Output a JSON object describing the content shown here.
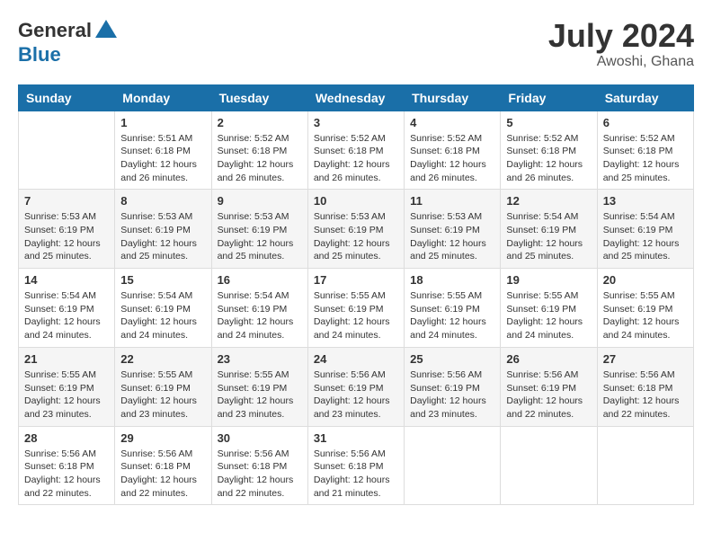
{
  "header": {
    "logo_general": "General",
    "logo_blue": "Blue",
    "month_year": "July 2024",
    "location": "Awoshi, Ghana"
  },
  "days_of_week": [
    "Sunday",
    "Monday",
    "Tuesday",
    "Wednesday",
    "Thursday",
    "Friday",
    "Saturday"
  ],
  "weeks": [
    [
      {
        "day": "",
        "sunrise": "",
        "sunset": "",
        "daylight": ""
      },
      {
        "day": "1",
        "sunrise": "Sunrise: 5:51 AM",
        "sunset": "Sunset: 6:18 PM",
        "daylight": "Daylight: 12 hours and 26 minutes."
      },
      {
        "day": "2",
        "sunrise": "Sunrise: 5:52 AM",
        "sunset": "Sunset: 6:18 PM",
        "daylight": "Daylight: 12 hours and 26 minutes."
      },
      {
        "day": "3",
        "sunrise": "Sunrise: 5:52 AM",
        "sunset": "Sunset: 6:18 PM",
        "daylight": "Daylight: 12 hours and 26 minutes."
      },
      {
        "day": "4",
        "sunrise": "Sunrise: 5:52 AM",
        "sunset": "Sunset: 6:18 PM",
        "daylight": "Daylight: 12 hours and 26 minutes."
      },
      {
        "day": "5",
        "sunrise": "Sunrise: 5:52 AM",
        "sunset": "Sunset: 6:18 PM",
        "daylight": "Daylight: 12 hours and 26 minutes."
      },
      {
        "day": "6",
        "sunrise": "Sunrise: 5:52 AM",
        "sunset": "Sunset: 6:18 PM",
        "daylight": "Daylight: 12 hours and 25 minutes."
      }
    ],
    [
      {
        "day": "7",
        "sunrise": "Sunrise: 5:53 AM",
        "sunset": "Sunset: 6:19 PM",
        "daylight": "Daylight: 12 hours and 25 minutes."
      },
      {
        "day": "8",
        "sunrise": "Sunrise: 5:53 AM",
        "sunset": "Sunset: 6:19 PM",
        "daylight": "Daylight: 12 hours and 25 minutes."
      },
      {
        "day": "9",
        "sunrise": "Sunrise: 5:53 AM",
        "sunset": "Sunset: 6:19 PM",
        "daylight": "Daylight: 12 hours and 25 minutes."
      },
      {
        "day": "10",
        "sunrise": "Sunrise: 5:53 AM",
        "sunset": "Sunset: 6:19 PM",
        "daylight": "Daylight: 12 hours and 25 minutes."
      },
      {
        "day": "11",
        "sunrise": "Sunrise: 5:53 AM",
        "sunset": "Sunset: 6:19 PM",
        "daylight": "Daylight: 12 hours and 25 minutes."
      },
      {
        "day": "12",
        "sunrise": "Sunrise: 5:54 AM",
        "sunset": "Sunset: 6:19 PM",
        "daylight": "Daylight: 12 hours and 25 minutes."
      },
      {
        "day": "13",
        "sunrise": "Sunrise: 5:54 AM",
        "sunset": "Sunset: 6:19 PM",
        "daylight": "Daylight: 12 hours and 25 minutes."
      }
    ],
    [
      {
        "day": "14",
        "sunrise": "Sunrise: 5:54 AM",
        "sunset": "Sunset: 6:19 PM",
        "daylight": "Daylight: 12 hours and 24 minutes."
      },
      {
        "day": "15",
        "sunrise": "Sunrise: 5:54 AM",
        "sunset": "Sunset: 6:19 PM",
        "daylight": "Daylight: 12 hours and 24 minutes."
      },
      {
        "day": "16",
        "sunrise": "Sunrise: 5:54 AM",
        "sunset": "Sunset: 6:19 PM",
        "daylight": "Daylight: 12 hours and 24 minutes."
      },
      {
        "day": "17",
        "sunrise": "Sunrise: 5:55 AM",
        "sunset": "Sunset: 6:19 PM",
        "daylight": "Daylight: 12 hours and 24 minutes."
      },
      {
        "day": "18",
        "sunrise": "Sunrise: 5:55 AM",
        "sunset": "Sunset: 6:19 PM",
        "daylight": "Daylight: 12 hours and 24 minutes."
      },
      {
        "day": "19",
        "sunrise": "Sunrise: 5:55 AM",
        "sunset": "Sunset: 6:19 PM",
        "daylight": "Daylight: 12 hours and 24 minutes."
      },
      {
        "day": "20",
        "sunrise": "Sunrise: 5:55 AM",
        "sunset": "Sunset: 6:19 PM",
        "daylight": "Daylight: 12 hours and 24 minutes."
      }
    ],
    [
      {
        "day": "21",
        "sunrise": "Sunrise: 5:55 AM",
        "sunset": "Sunset: 6:19 PM",
        "daylight": "Daylight: 12 hours and 23 minutes."
      },
      {
        "day": "22",
        "sunrise": "Sunrise: 5:55 AM",
        "sunset": "Sunset: 6:19 PM",
        "daylight": "Daylight: 12 hours and 23 minutes."
      },
      {
        "day": "23",
        "sunrise": "Sunrise: 5:55 AM",
        "sunset": "Sunset: 6:19 PM",
        "daylight": "Daylight: 12 hours and 23 minutes."
      },
      {
        "day": "24",
        "sunrise": "Sunrise: 5:56 AM",
        "sunset": "Sunset: 6:19 PM",
        "daylight": "Daylight: 12 hours and 23 minutes."
      },
      {
        "day": "25",
        "sunrise": "Sunrise: 5:56 AM",
        "sunset": "Sunset: 6:19 PM",
        "daylight": "Daylight: 12 hours and 23 minutes."
      },
      {
        "day": "26",
        "sunrise": "Sunrise: 5:56 AM",
        "sunset": "Sunset: 6:19 PM",
        "daylight": "Daylight: 12 hours and 22 minutes."
      },
      {
        "day": "27",
        "sunrise": "Sunrise: 5:56 AM",
        "sunset": "Sunset: 6:18 PM",
        "daylight": "Daylight: 12 hours and 22 minutes."
      }
    ],
    [
      {
        "day": "28",
        "sunrise": "Sunrise: 5:56 AM",
        "sunset": "Sunset: 6:18 PM",
        "daylight": "Daylight: 12 hours and 22 minutes."
      },
      {
        "day": "29",
        "sunrise": "Sunrise: 5:56 AM",
        "sunset": "Sunset: 6:18 PM",
        "daylight": "Daylight: 12 hours and 22 minutes."
      },
      {
        "day": "30",
        "sunrise": "Sunrise: 5:56 AM",
        "sunset": "Sunset: 6:18 PM",
        "daylight": "Daylight: 12 hours and 22 minutes."
      },
      {
        "day": "31",
        "sunrise": "Sunrise: 5:56 AM",
        "sunset": "Sunset: 6:18 PM",
        "daylight": "Daylight: 12 hours and 21 minutes."
      },
      {
        "day": "",
        "sunrise": "",
        "sunset": "",
        "daylight": ""
      },
      {
        "day": "",
        "sunrise": "",
        "sunset": "",
        "daylight": ""
      },
      {
        "day": "",
        "sunrise": "",
        "sunset": "",
        "daylight": ""
      }
    ]
  ]
}
